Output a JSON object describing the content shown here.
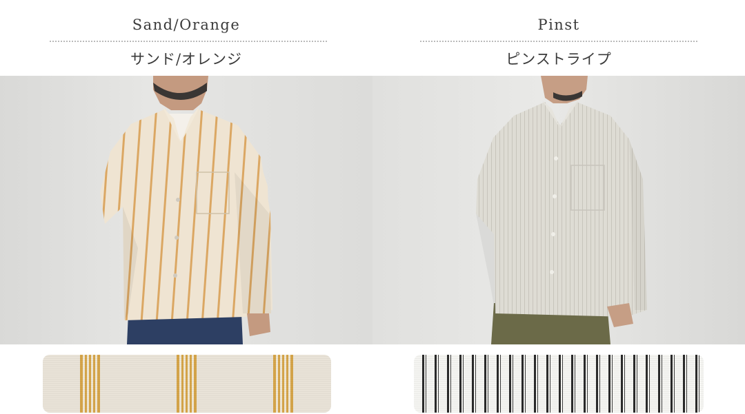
{
  "colors_section": {
    "items": [
      {
        "name_en": "Sand/Orange",
        "name_ja": "サンド/オレンジ",
        "photo_icon": "model-wearing-striped-shirt-photo",
        "swatch_icon": "fabric-swatch-icon",
        "colors": {
          "shirt": "#efe4d2",
          "stripe": "#d5a54a",
          "pants": "#2d3f63"
        }
      },
      {
        "name_en": "Pinst",
        "name_ja": "ピンストライプ",
        "photo_icon": "model-wearing-pinstripe-shirt-photo",
        "swatch_icon": "fabric-swatch-icon",
        "colors": {
          "shirt": "#dcdad2",
          "stripe": "#2a2a2a",
          "pants": "#6b6a48"
        }
      }
    ]
  }
}
